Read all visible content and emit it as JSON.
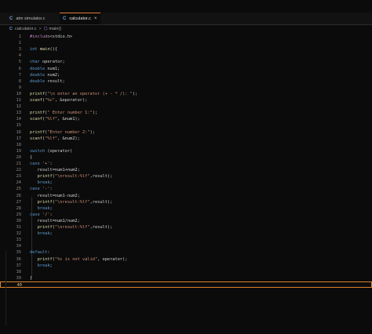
{
  "tabs": [
    {
      "icon": "C",
      "label": "atm simulator.c",
      "active": false
    },
    {
      "icon": "C",
      "label": "calculator.c",
      "active": true,
      "close": "×"
    }
  ],
  "breadcrumb": {
    "icon": "C",
    "file": "calculator.c",
    "sep": ">",
    "symbol_icon": "⬡",
    "symbol": "main()"
  },
  "colors": {
    "accent": "#d9822b",
    "keyword": "#5f9ed6",
    "string": "#ce9178"
  },
  "editor": {
    "lines": [
      {
        "n": "1",
        "text": "#include<stdio.h>"
      },
      {
        "n": "2",
        "text": ""
      },
      {
        "n": "3",
        "text": "int main(){"
      },
      {
        "n": "4",
        "text": ""
      },
      {
        "n": "5",
        "text": "char operator;"
      },
      {
        "n": "6",
        "text": "double num1;"
      },
      {
        "n": "7",
        "text": "double num2;"
      },
      {
        "n": "8",
        "text": "double result;"
      },
      {
        "n": "9",
        "text": ""
      },
      {
        "n": "10",
        "text": "printf(\"\\n enter an operator (+ - * /): \");"
      },
      {
        "n": "11",
        "text": "scanf(\"%c\", &operator);"
      },
      {
        "n": "12",
        "text": ""
      },
      {
        "n": "13",
        "text": "printf(\" Enter number 1:\");"
      },
      {
        "n": "14",
        "text": "scanf(\"%lf\", &num1);"
      },
      {
        "n": "15",
        "text": ""
      },
      {
        "n": "16",
        "text": "printf(\"Enter number 2:\");"
      },
      {
        "n": "17",
        "text": "scanf(\"%lf\", &num2);"
      },
      {
        "n": "18",
        "text": ""
      },
      {
        "n": "19",
        "text": "switch (operator)"
      },
      {
        "n": "20",
        "text": "{"
      },
      {
        "n": "21",
        "text": "case '+':"
      },
      {
        "n": "22",
        "text": "   result=num1+num2;"
      },
      {
        "n": "23",
        "text": "   printf(\"\\nresult:%lf\",result);"
      },
      {
        "n": "24",
        "text": "   break;"
      },
      {
        "n": "25",
        "text": "case '-':"
      },
      {
        "n": "26",
        "text": "   result=num1-num2;"
      },
      {
        "n": "27",
        "text": "   printf(\"\\nresult:%lf\",result);"
      },
      {
        "n": "28",
        "text": "   break;"
      },
      {
        "n": "29",
        "text": "case '/':"
      },
      {
        "n": "30",
        "text": "   result=num1/num2;"
      },
      {
        "n": "31",
        "text": "   printf(\"\\nresult:%lf\",result);"
      },
      {
        "n": "32",
        "text": "   break;"
      },
      {
        "n": "33",
        "text": ""
      },
      {
        "n": "34",
        "text": ""
      },
      {
        "n": "35",
        "text": "default:"
      },
      {
        "n": "36",
        "text": "   printf(\"%c is not valid\", operator);"
      },
      {
        "n": "37",
        "text": "   break;"
      },
      {
        "n": "38",
        "text": ""
      },
      {
        "n": "39",
        "text": "}"
      },
      {
        "n": "40",
        "text": "",
        "current": true
      }
    ]
  }
}
